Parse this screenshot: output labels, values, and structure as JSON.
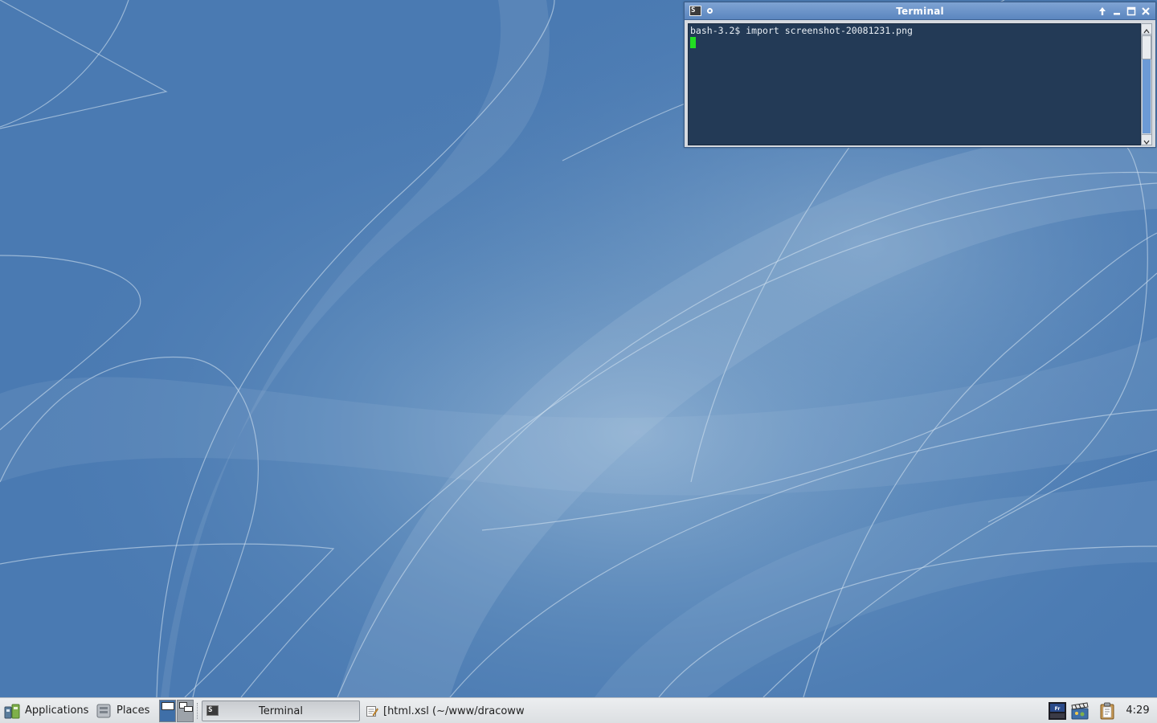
{
  "terminal": {
    "title": "Terminal",
    "prompt": "bash-3.2$",
    "command": "import screenshot-20081231.png",
    "cursor_color": "#22dd22",
    "background_color": "#233a56"
  },
  "panel": {
    "applications_label": "Applications",
    "places_label": "Places",
    "workspaces": [
      "workspace-1",
      "workspace-2"
    ],
    "tasks": [
      {
        "label": "Terminal",
        "icon": "terminal-icon",
        "active": true
      },
      {
        "label": "[html.xsl (~/www/dracoww...",
        "icon": "text-editor-icon",
        "active": false
      }
    ],
    "tray_icons": [
      "film-icon",
      "clapperboard-icon",
      "clipboard-icon"
    ],
    "clock": "4:29"
  },
  "desktop": {
    "background_color": "#4a7ab2"
  }
}
